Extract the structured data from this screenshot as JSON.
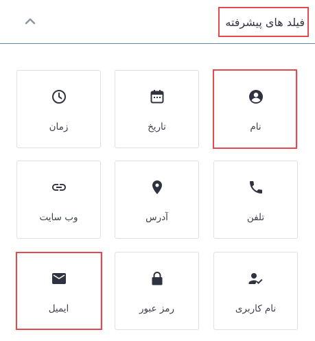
{
  "section": {
    "title": "فیلد های پیشرفته",
    "toggle_icon": "chevron-up-icon"
  },
  "fields": [
    {
      "label": "نام",
      "icon": "account-circle-icon"
    },
    {
      "label": "تاریخ",
      "icon": "calendar-icon"
    },
    {
      "label": "زمان",
      "icon": "clock-icon"
    },
    {
      "label": "تلفن",
      "icon": "phone-icon"
    },
    {
      "label": "آدرس",
      "icon": "map-pin-icon"
    },
    {
      "label": "وب سایت",
      "icon": "link-icon"
    },
    {
      "label": "نام کاربری",
      "icon": "user-check-icon"
    },
    {
      "label": "رمز عبور",
      "icon": "lock-icon"
    },
    {
      "label": "ایمیل",
      "icon": "envelope-icon"
    }
  ],
  "colors": {
    "icon": "#2f3340",
    "text": "#3a3f4b",
    "card_border": "#dcdfe5",
    "header_divider": "#5d88a8",
    "highlight": "#e5484d",
    "chevron": "#8a93a0"
  }
}
